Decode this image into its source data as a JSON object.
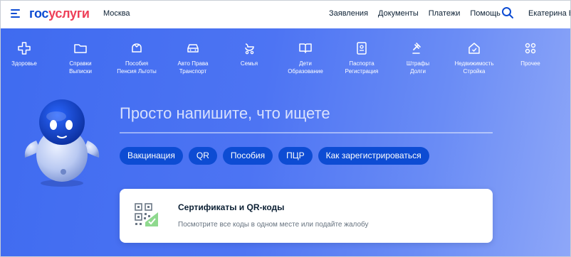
{
  "header": {
    "logo_part1": "гос",
    "logo_part2": "услуги",
    "city": "Москва",
    "nav": [
      "Заявления",
      "Документы",
      "Платежи",
      "Помощь"
    ],
    "user": "Екатерина Б."
  },
  "categories": [
    {
      "label": "Здоровье",
      "icon": "cross-icon"
    },
    {
      "label": "Справки\nВыписки",
      "icon": "folder-icon"
    },
    {
      "label": "Пособия\nПенсия Льготы",
      "icon": "wallet-icon"
    },
    {
      "label": "Авто Права\nТранспорт",
      "icon": "car-icon"
    },
    {
      "label": "Семья",
      "icon": "stroller-icon"
    },
    {
      "label": "Дети\nОбразование",
      "icon": "book-icon"
    },
    {
      "label": "Паспорта\nРегистрация",
      "icon": "passport-icon"
    },
    {
      "label": "Штрафы\nДолги",
      "icon": "gavel-icon"
    },
    {
      "label": "Недвижимость\nСтройка",
      "icon": "house-icon"
    },
    {
      "label": "Прочее",
      "icon": "grid-icon"
    }
  ],
  "search": {
    "placeholder": "Просто напишите, что ищете"
  },
  "chips": [
    "Вакцинация",
    "QR",
    "Пособия",
    "ПЦР",
    "Как зарегистрироваться"
  ],
  "card": {
    "title": "Сертификаты и QR-коды",
    "subtitle": "Посмотрите все коды в одном месте или подайте жалобу"
  },
  "colors": {
    "accent": "#0d4cd3",
    "logo_red": "#ee3f58",
    "hero_start": "#3f6bf0",
    "hero_end": "#8ea7f8"
  }
}
